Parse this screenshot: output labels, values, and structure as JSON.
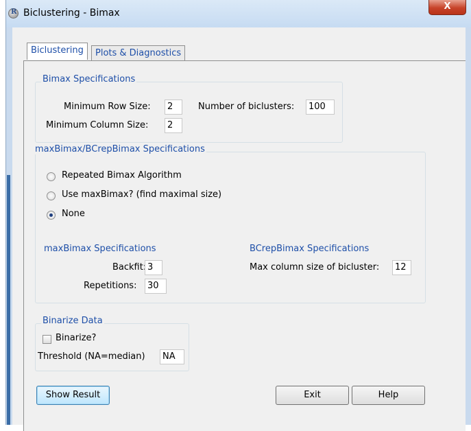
{
  "window": {
    "title": "Biclustering - Bimax",
    "icon": "R",
    "close_label": "X"
  },
  "tabs": [
    {
      "label": "Biclustering",
      "active": true
    },
    {
      "label": "Plots & Diagnostics",
      "active": false
    }
  ],
  "bimax_specs": {
    "legend": "Bimax Specifications",
    "min_row_label": "Minimum Row Size:",
    "min_row_value": "2",
    "min_col_label": "Minimum Column Size:",
    "min_col_value": "2",
    "num_biclusters_label": "Number of biclusters:",
    "num_biclusters_value": "100"
  },
  "max_specs": {
    "legend": "maxBimax/BCrepBimax Specifications",
    "options": [
      {
        "label": "Repeated Bimax Algorithm",
        "checked": false
      },
      {
        "label": "Use maxBimax? (find maximal size)",
        "checked": false
      },
      {
        "label": "None",
        "checked": true
      }
    ],
    "maxbimax_title": "maxBimax Specifications",
    "backfit_label": "Backfit:",
    "backfit_value": "3",
    "repetitions_label": "Repetitions:",
    "repetitions_value": "30",
    "bcrep_title": "BCrepBimax Specifications",
    "max_col_label": "Max column size of bicluster:",
    "max_col_value": "12"
  },
  "binarize": {
    "legend": "Binarize Data",
    "checkbox_label": "Binarize?",
    "checked": false,
    "threshold_label": "Threshold (NA=median)",
    "threshold_value": "NA"
  },
  "buttons": {
    "show_result": "Show Result",
    "exit": "Exit",
    "help": "Help"
  },
  "colors": {
    "accent_text": "#1e4fa8",
    "close_button": "#c7432a",
    "background": "#f0f0f0"
  }
}
